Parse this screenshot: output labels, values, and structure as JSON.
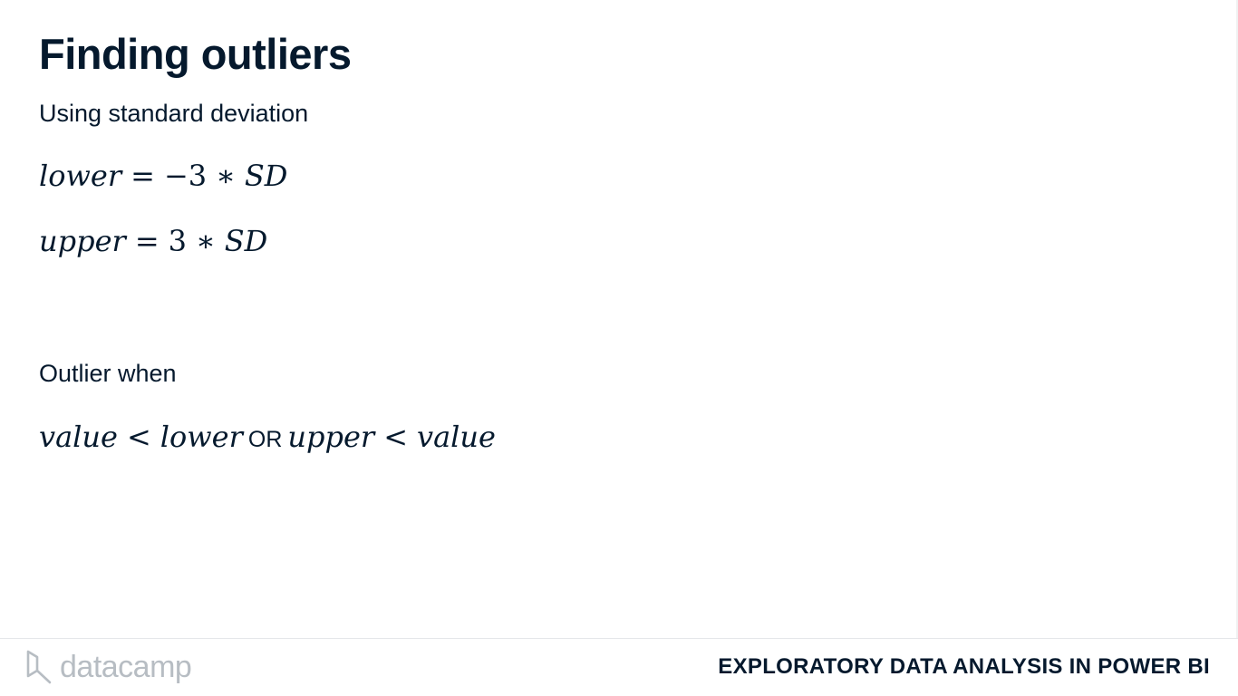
{
  "slide": {
    "title": "Finding outliers",
    "subtitle": "Using standard deviation",
    "formula_lower": {
      "lhs": "lower",
      "eq": "=",
      "neg": "−3",
      "mul": "∗",
      "rhs": "SD"
    },
    "formula_upper": {
      "lhs": "upper",
      "eq": "=",
      "num": "3",
      "mul": "∗",
      "rhs": "SD"
    },
    "outlier_label": "Outlier when",
    "condition": {
      "left_value": "value",
      "lt1": "<",
      "lower": "lower",
      "or": "OR",
      "upper": "upper",
      "lt2": "<",
      "right_value": "value"
    }
  },
  "footer": {
    "logo_text": "datacamp",
    "course_title": "EXPLORATORY DATA ANALYSIS IN POWER BI"
  },
  "colors": {
    "text": "#05192d",
    "logo": "#b7bdc3",
    "divider": "#e5e7ea"
  }
}
